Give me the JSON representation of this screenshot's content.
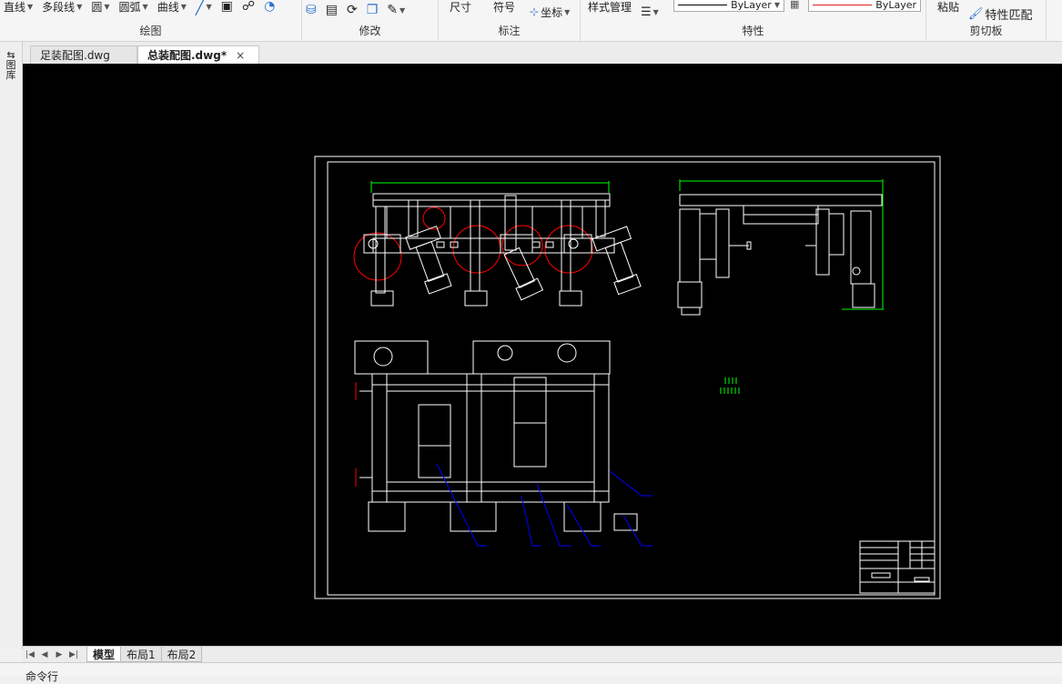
{
  "ribbon": {
    "groups": [
      {
        "title": "绘图",
        "tools": [
          "直线",
          "多段线",
          "圆",
          "圆弧",
          "曲线"
        ]
      },
      {
        "title": "修改",
        "tools": []
      },
      {
        "title": "标注",
        "tools": [
          "尺寸",
          "符号",
          "坐标"
        ]
      },
      {
        "title": "特性",
        "tools": [
          "样式管理"
        ],
        "linetype": "ByLayer",
        "color": "ByLayer"
      },
      {
        "title": "剪切板",
        "tools": [
          "粘贴",
          "特性匹配"
        ]
      }
    ]
  },
  "doc_tabs": [
    {
      "label": "足装配图.dwg",
      "active": false
    },
    {
      "label": "总装配图.dwg*",
      "active": true,
      "close": "×"
    }
  ],
  "left_panel": {
    "label": "图库"
  },
  "layout_tabs": [
    {
      "label": "模型",
      "active": true
    },
    {
      "label": "布局1",
      "active": false
    },
    {
      "label": "布局2",
      "active": false
    }
  ],
  "command_line": {
    "label": "命令行"
  },
  "colors": {
    "canvas": "#000000",
    "drawing_line": "#ffffff",
    "dimension": "#00ff00",
    "wheel": "#ff0000",
    "leader": "#0000ff"
  }
}
